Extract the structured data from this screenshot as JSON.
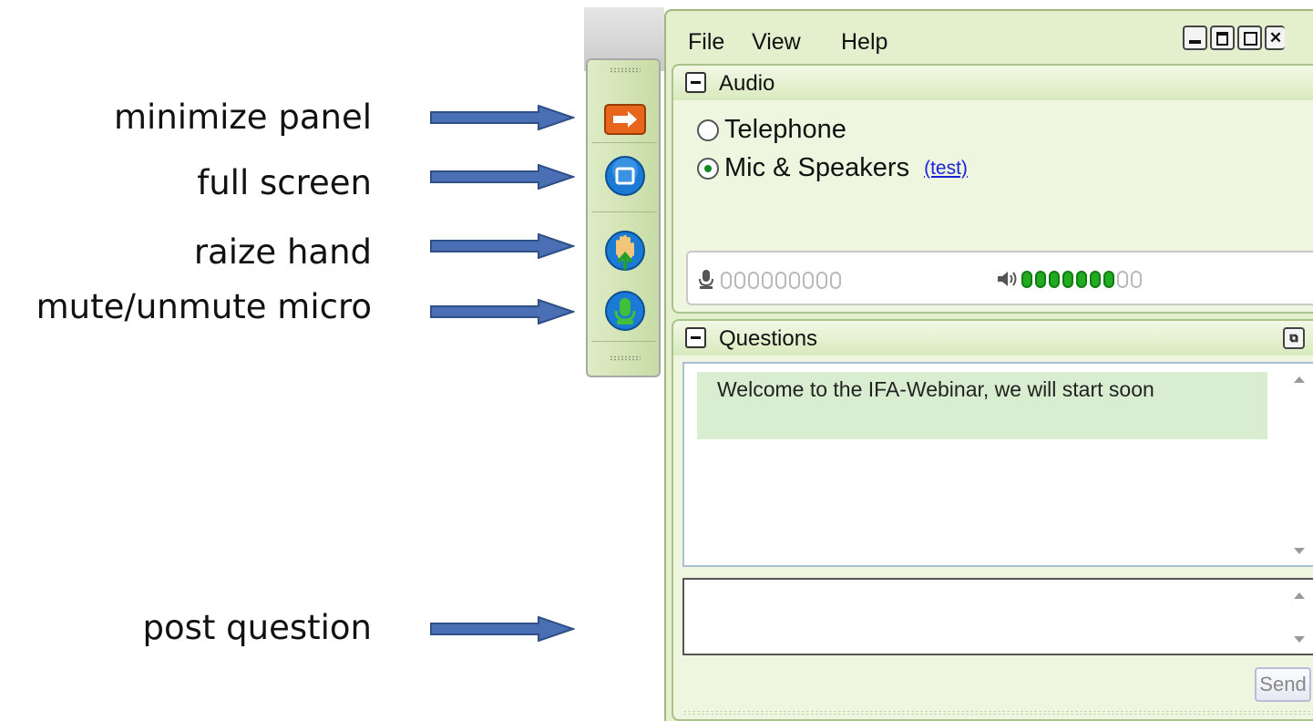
{
  "annotations": [
    {
      "label": "minimize panel"
    },
    {
      "label": "full screen"
    },
    {
      "label": "raize hand"
    },
    {
      "label": "mute/unmute micro"
    },
    {
      "label": "post question"
    }
  ],
  "toolbar": {
    "buttons": [
      {
        "name": "minimize-panel",
        "icon": "arrow-right-icon",
        "color": "#e8651c"
      },
      {
        "name": "full-screen",
        "icon": "fullscreen-icon",
        "color": "#1a7ad4"
      },
      {
        "name": "raise-hand",
        "icon": "hand-up-icon",
        "color": "#1a7ad4"
      },
      {
        "name": "mute-unmute",
        "icon": "microphone-icon",
        "color": "#1a7ad4"
      }
    ]
  },
  "menubar": {
    "items": [
      "File",
      "View",
      "Help"
    ]
  },
  "window_controls": [
    "minimize",
    "restore",
    "popout",
    "close"
  ],
  "audio": {
    "title": "Audio",
    "options": [
      {
        "label": "Telephone",
        "selected": false
      },
      {
        "label": "Mic & Speakers",
        "selected": true
      }
    ],
    "test_link": "(test)",
    "mic_level": {
      "segments": 9,
      "lit": 0
    },
    "speaker_level": {
      "segments": 9,
      "lit": 7
    }
  },
  "questions": {
    "title": "Questions",
    "messages": [
      "Welcome to the IFA-Webinar, we will start soon"
    ],
    "input_value": "",
    "send_label": "Send"
  },
  "colors": {
    "panel_green": "#e3efcd",
    "accent_orange": "#e8651c",
    "accent_blue": "#1a7ad4",
    "arrow_blue": "#4a6fb5",
    "meter_on": "#22aa22"
  }
}
